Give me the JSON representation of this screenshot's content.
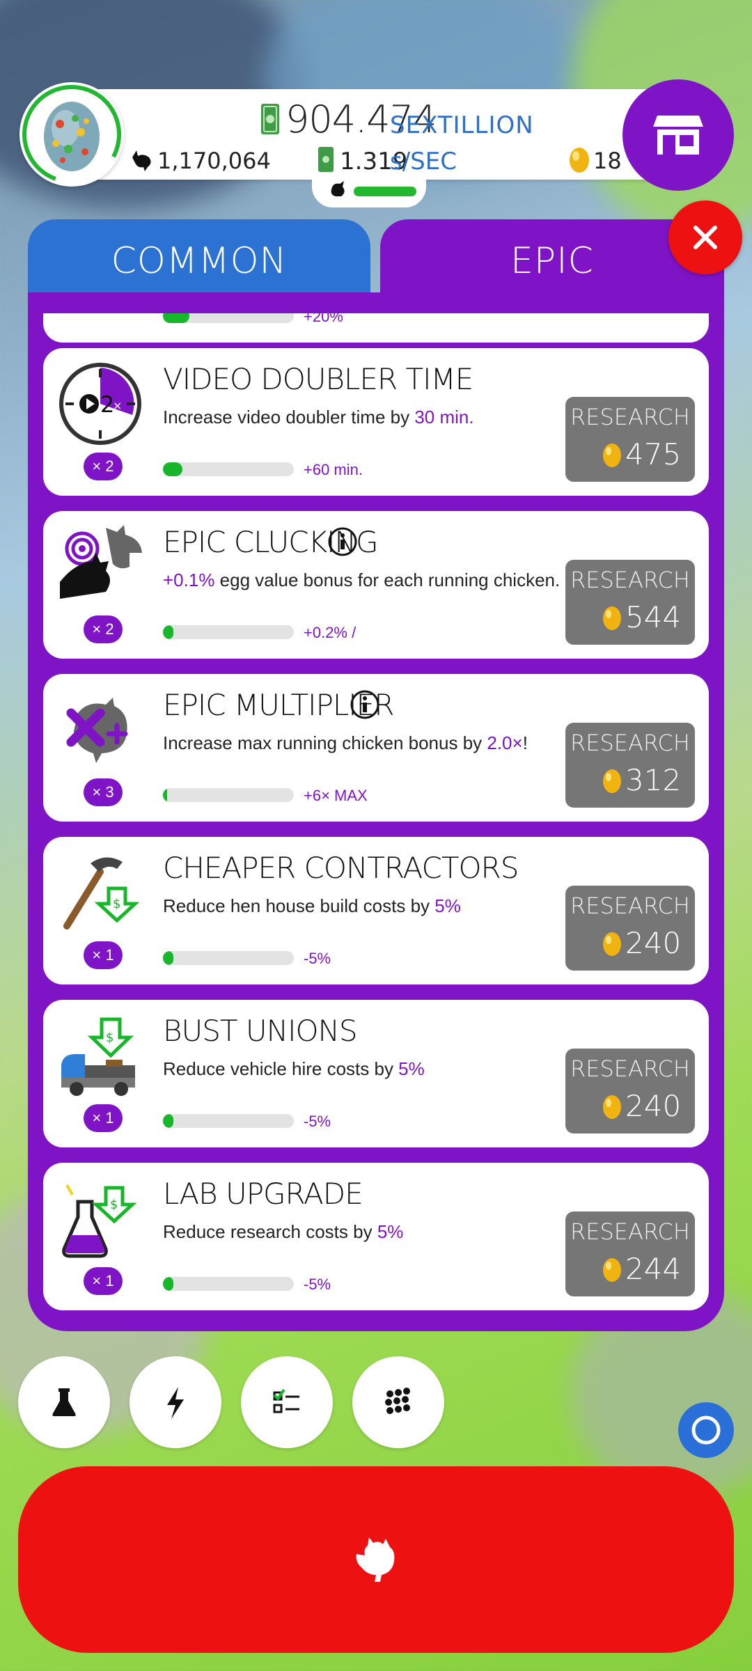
{
  "hud": {
    "money_value": "904.474",
    "money_unit": "SEXTILLION",
    "chicken_count": "1,170,064",
    "rate_value": "1.319",
    "rate_unit": "s/SEC",
    "golden_eggs": "18"
  },
  "tabs": [
    {
      "label": "COMMON",
      "active": false
    },
    {
      "label": "EPIC",
      "active": true
    }
  ],
  "research_items": [
    {
      "title": "VIDEO DOUBLER TIME",
      "desc_before": "Increase video doubler time by ",
      "desc_highlight": "30 min.",
      "desc_after": "",
      "level": "× 2",
      "step": "+60 min.",
      "progress": 0.15,
      "button_label": "RESEARCH",
      "cost": "475",
      "icon": "stopwatch-icon",
      "has_info": false
    },
    {
      "title": "EPIC CLUCKING",
      "desc_before": "",
      "desc_highlight": "+0.1%",
      "desc_after": " egg value bonus for each running chicken.",
      "level": "× 2",
      "step": "+0.2% /",
      "progress": 0.08,
      "button_label": "RESEARCH",
      "cost": "544",
      "icon": "chicken-clucking-icon",
      "has_info": true
    },
    {
      "title": "EPIC MULTIPLIER",
      "desc_before": "Increase max running chicken bonus by ",
      "desc_highlight": "2.0×",
      "desc_after": "!",
      "level": "× 3",
      "step": "+6× MAX",
      "progress": 0.03,
      "button_label": "RESEARCH",
      "cost": "312",
      "icon": "chicken-multiplier-icon",
      "has_info": true
    },
    {
      "title": "CHEAPER CONTRACTORS",
      "desc_before": "Reduce hen house build costs by ",
      "desc_highlight": "5%",
      "desc_after": "",
      "level": "× 1",
      "step": "-5%",
      "progress": 0.08,
      "button_label": "RESEARCH",
      "cost": "240",
      "icon": "hammer-discount-icon",
      "has_info": false
    },
    {
      "title": "BUST UNIONS",
      "desc_before": "Reduce vehicle hire costs by ",
      "desc_highlight": "5%",
      "desc_after": "",
      "level": "× 1",
      "step": "-5%",
      "progress": 0.08,
      "button_label": "RESEARCH",
      "cost": "240",
      "icon": "truck-discount-icon",
      "has_info": false
    },
    {
      "title": "LAB UPGRADE",
      "desc_before": "Reduce research costs by ",
      "desc_highlight": "5%",
      "desc_after": "",
      "level": "× 1",
      "step": "-5%",
      "progress": 0.08,
      "button_label": "RESEARCH",
      "cost": "244",
      "icon": "flask-discount-icon",
      "has_info": false
    }
  ],
  "partial_item": {
    "step": "+20%",
    "progress": 0.2
  },
  "nav": [
    "flask-icon",
    "lightning-icon",
    "checklist-icon",
    "grid-icon"
  ],
  "colors": {
    "epic": "#7f13c6",
    "common": "#2c72d3",
    "hatch": "#ee1111",
    "progress": "#18b62a"
  }
}
